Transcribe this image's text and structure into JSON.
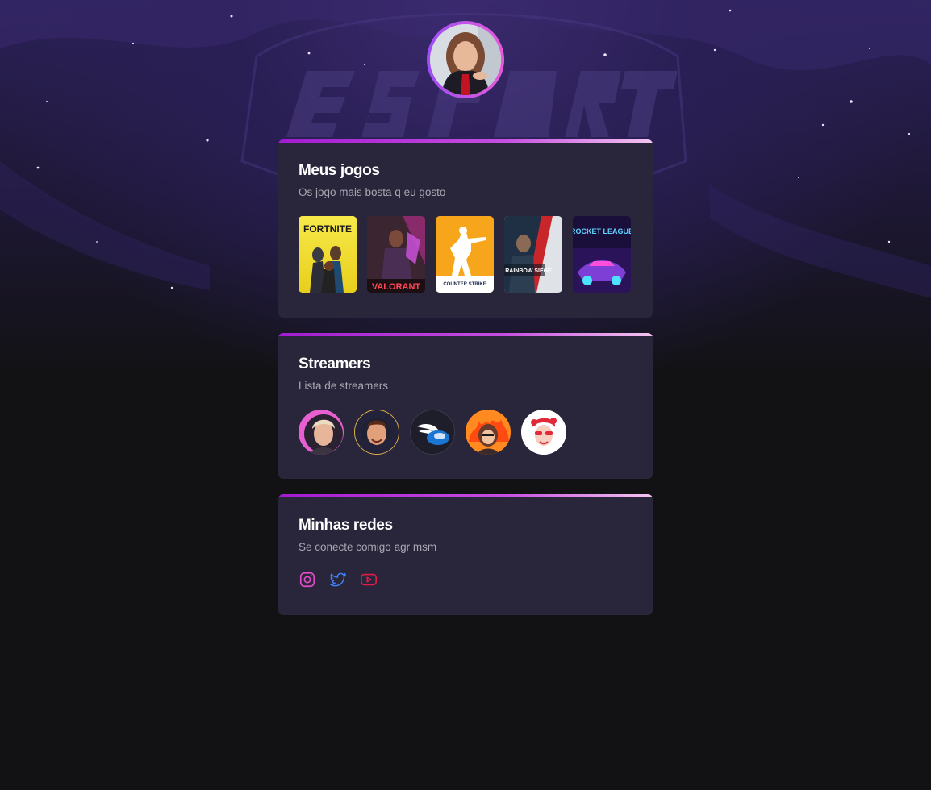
{
  "profile": {
    "avatar_icon": "profile-photo"
  },
  "sections": {
    "games": {
      "title": "Meus jogos",
      "subtitle": "Os jogo mais bosta q eu gosto",
      "items": [
        {
          "name": "Fortnite",
          "logo_text": "FORTNITE"
        },
        {
          "name": "Valorant",
          "logo_text": "VALORANT"
        },
        {
          "name": "Counter-Strike",
          "logo_text": "COUNTER STRIKE"
        },
        {
          "name": "Rainbow Six Siege",
          "logo_text": "RAINBOW SIEGE"
        },
        {
          "name": "Rocket League",
          "logo_text": "ROCKET LEAGUE"
        }
      ]
    },
    "streamers": {
      "title": "Streamers",
      "subtitle": "Lista de streamers",
      "items": [
        {
          "icon": "streamer-blond-avatar"
        },
        {
          "icon": "streamer-cartoon-headphones-avatar"
        },
        {
          "icon": "streamer-wing-logo-avatar"
        },
        {
          "icon": "streamer-fire-avatar"
        },
        {
          "icon": "streamer-red-hair-avatar"
        }
      ]
    },
    "socials": {
      "title": "Minhas redes",
      "subtitle": "Se conecte comigo agr msm",
      "items": [
        {
          "icon": "instagram-icon",
          "color": "#e34cc9"
        },
        {
          "icon": "twitter-icon",
          "color": "#3b82f6"
        },
        {
          "icon": "youtube-icon",
          "color": "#e11d48"
        }
      ]
    }
  },
  "colors": {
    "page_bg": "#121214",
    "card_bg": "#29253a",
    "accent_start": "#a21bd1",
    "accent_end": "#f3c5f0"
  }
}
